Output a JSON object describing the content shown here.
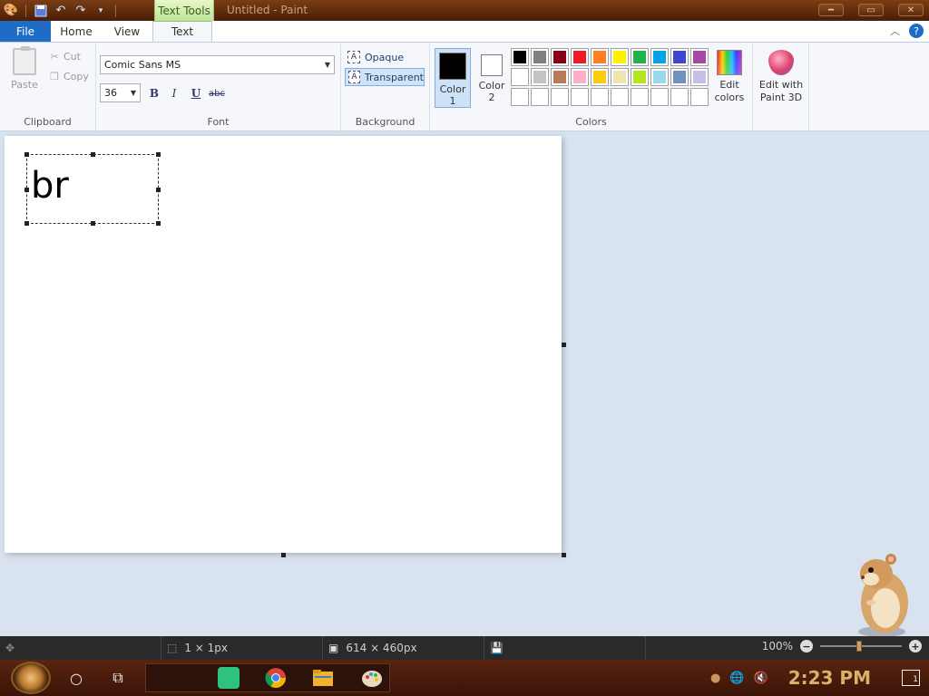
{
  "titlebar": {
    "context_tab": "Text Tools",
    "window_title": "Untitled - Paint",
    "window_controls": [
      "minimize",
      "maximize",
      "close"
    ]
  },
  "tabs": {
    "file": "File",
    "home": "Home",
    "view": "View",
    "text": "Text",
    "active": "Text"
  },
  "clipboard": {
    "paste": "Paste",
    "cut": "Cut",
    "copy": "Copy",
    "label": "Clipboard"
  },
  "font": {
    "family": "Comic Sans MS",
    "size": "36",
    "bold": "B",
    "italic": "I",
    "underline": "U",
    "strikethrough": "abc",
    "label": "Font"
  },
  "background": {
    "opaque": "Opaque",
    "transparent": "Transparent",
    "selected": "transparent",
    "label": "Background"
  },
  "colors": {
    "color1_label": "Color",
    "color1_num": "1",
    "color1_value": "#000000",
    "color2_label": "Color",
    "color2_num": "2",
    "color2_value": "#ffffff",
    "palette": [
      "#000000",
      "#7f7f7f",
      "#880015",
      "#ed1c24",
      "#ff7f27",
      "#fff200",
      "#22b14c",
      "#00a2e8",
      "#3f48cc",
      "#a349a4",
      "#ffffff",
      "#c3c3c3",
      "#b97a57",
      "#ffaec9",
      "#ffc90e",
      "#efe4b0",
      "#b5e61d",
      "#99d9ea",
      "#7092be",
      "#c8bfe7",
      "#ffffff",
      "#ffffff",
      "#ffffff",
      "#ffffff",
      "#ffffff",
      "#ffffff",
      "#ffffff",
      "#ffffff",
      "#ffffff",
      "#ffffff"
    ],
    "edit_colors_1": "Edit",
    "edit_colors_2": "colors",
    "paint3d_1": "Edit with",
    "paint3d_2": "Paint 3D",
    "label": "Colors"
  },
  "canvas": {
    "text_content": "br"
  },
  "status": {
    "cursor": "1 × 1px",
    "size": "614 × 460px",
    "zoom": "100%"
  },
  "taskbar": {
    "clock": "2:23 PM",
    "notifications": "1"
  }
}
